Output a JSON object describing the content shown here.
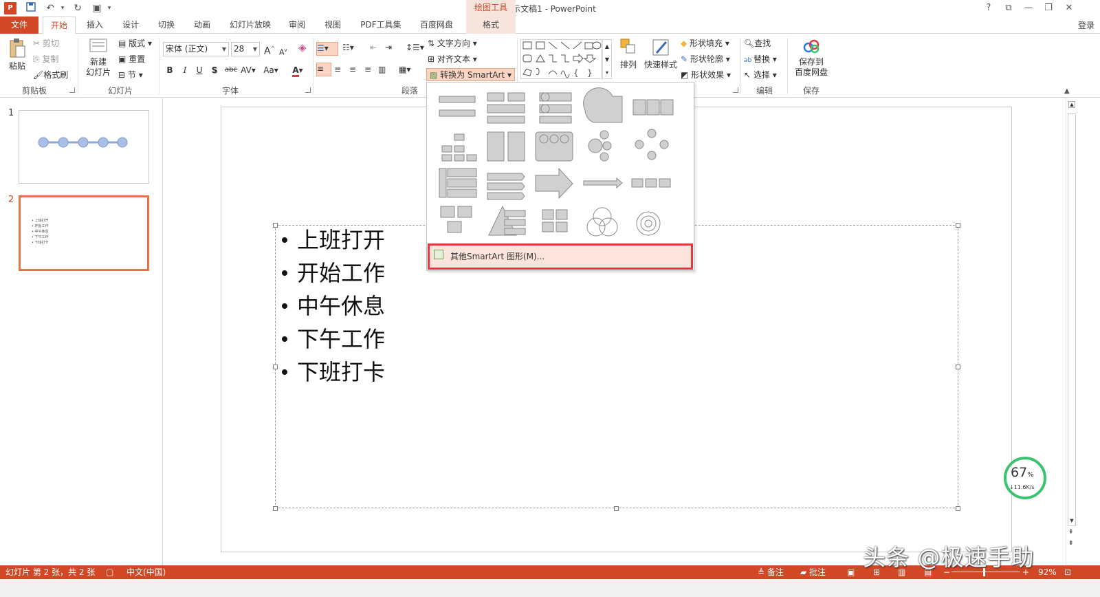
{
  "app": {
    "document_title": "演示文稿1 - PowerPoint",
    "context_tab_group": "绘图工具",
    "login": "登录",
    "accent": "#d24726"
  },
  "window_controls": [
    "?",
    "⧉",
    "—",
    "❐",
    "✕"
  ],
  "tabs": [
    {
      "label": "文件"
    },
    {
      "label": "开始"
    },
    {
      "label": "插入"
    },
    {
      "label": "设计"
    },
    {
      "label": "切换"
    },
    {
      "label": "动画"
    },
    {
      "label": "幻灯片放映"
    },
    {
      "label": "审阅"
    },
    {
      "label": "视图"
    },
    {
      "label": "PDF工具集"
    },
    {
      "label": "百度网盘"
    },
    {
      "label": "格式"
    }
  ],
  "ribbon": {
    "clipboard": {
      "paste": "粘贴",
      "cut": "剪切",
      "copy": "复制",
      "format_painter": "格式刷",
      "label": "剪贴板"
    },
    "slides": {
      "new_slide_1": "新建",
      "new_slide_2": "幻灯片",
      "layout": "版式",
      "reset": "重置",
      "section": "节",
      "label": "幻灯片"
    },
    "font": {
      "font_name": "宋体 (正文)",
      "font_size": "28",
      "label": "字体",
      "grow": "A",
      "shrink": "A",
      "bold": "B",
      "italic": "I",
      "underline": "U",
      "shadow": "S",
      "strike": "abc",
      "spacing": "AV",
      "case": "Aa"
    },
    "paragraph": {
      "text_direction": "文字方向",
      "align_text": "对齐文本",
      "convert_smartart": "转换为 SmartArt",
      "label": "段落"
    },
    "drawing": {
      "arrange": "排列",
      "quick_styles": "快速样式",
      "shape_fill": "形状填充",
      "shape_outline": "形状轮廓",
      "shape_effects": "形状效果"
    },
    "editing": {
      "find": "查找",
      "replace": "替换",
      "select": "选择",
      "label": "编辑"
    },
    "save": {
      "line1": "保存到",
      "line2": "百度网盘",
      "label": "保存"
    }
  },
  "smartart_menu": {
    "items": [
      "vertical-bullet-list",
      "stacked-list",
      "vertical-box-list",
      "target-list",
      "table-list",
      "hierarchy",
      "horizontal-hierarchy-list",
      "grouped-list",
      "radial-cluster",
      "cycle",
      "vertical-chevron-list",
      "chevron-list",
      "upward-arrow",
      "basic-timeline",
      "process",
      "picture-list",
      "pyramid-list",
      "matrix",
      "venn",
      "target"
    ],
    "more_label": "其他SmartArt 图形(M)..."
  },
  "thumbnails": [
    {
      "number": "1"
    },
    {
      "number": "2",
      "lines": [
        "上班打开",
        "开始工作",
        "中午休息",
        "下午工作",
        "下班打卡"
      ]
    }
  ],
  "slide": {
    "bullets": [
      "上班打开",
      "开始工作",
      "中午休息",
      "下午工作",
      "下班打卡"
    ]
  },
  "statusbar": {
    "slide_info": "幻灯片 第 2 张，共 2 张",
    "language": "中文(中国)",
    "notes": "备注",
    "comments": "批注",
    "zoom": "92%"
  },
  "netmeter": {
    "percent": "67",
    "unit": "%",
    "speed": "↓11.6K/s"
  },
  "watermark": "头条 @极速手助"
}
